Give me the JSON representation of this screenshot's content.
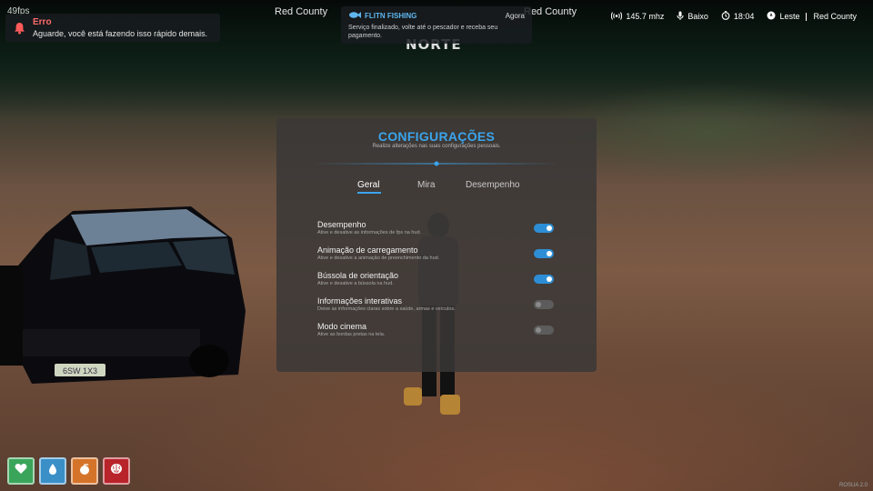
{
  "hud_top": {
    "fps": "49fps",
    "county_left": "Red County",
    "county_right": "Red County",
    "zone": "NORTE"
  },
  "error_toast": {
    "title": "Erro",
    "message": "Aguarde, você está fazendo isso rápido demais."
  },
  "fishing_toast": {
    "brand": "FLITN FISHING",
    "time": "Agora",
    "message": "Serviço finalizado, volte até o pescador e receba seu pagamento."
  },
  "status_bar": {
    "radio": "145.7 mhz",
    "voice": "Baixo",
    "clock": "18:04",
    "direction": "Leste",
    "location": "Red County"
  },
  "settings_panel": {
    "title": "CONFIGURAÇÕES",
    "subtitle": "Realize alterações nas suas configurações pessoais.",
    "tabs": [
      {
        "label": "Geral",
        "active": true
      },
      {
        "label": "Mira",
        "active": false
      },
      {
        "label": "Desempenho",
        "active": false
      }
    ],
    "items": [
      {
        "label": "Desempenho",
        "description": "Ative e desative as informações de fps na hud.",
        "enabled": true
      },
      {
        "label": "Animação de carregamento",
        "description": "Ative e desative a animação de preenchimento da hud.",
        "enabled": true
      },
      {
        "label": "Bússola de orientação",
        "description": "Ative e desative a bússola na hud.",
        "enabled": true
      },
      {
        "label": "Informações interativas",
        "description": "Deixe as informações claras sobre a saúde, armas e veículos.",
        "enabled": false
      },
      {
        "label": "Modo cinema",
        "description": "Ative as bordas pretas na tela.",
        "enabled": false
      }
    ],
    "accent_color": "#3ba4ec"
  },
  "status_hud": [
    {
      "name": "health",
      "icon": "heart-icon",
      "color": "#3aa55a"
    },
    {
      "name": "water",
      "icon": "drop-icon",
      "color": "#3a8fc7"
    },
    {
      "name": "food",
      "icon": "food-icon",
      "color": "#d4742a"
    },
    {
      "name": "stress",
      "icon": "brain-icon",
      "color": "#b8242a"
    }
  ],
  "version": "ROSUA 2.0"
}
